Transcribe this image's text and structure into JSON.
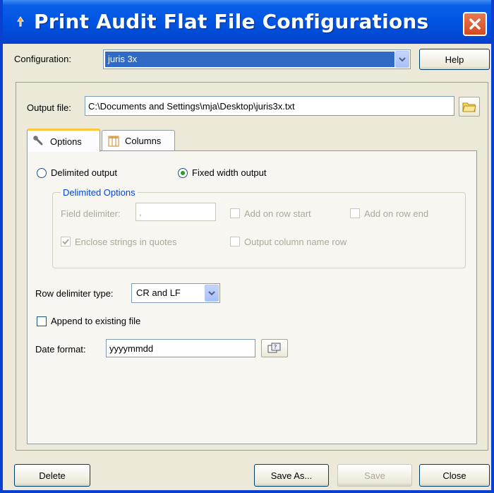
{
  "window": {
    "title": "Print Audit Flat File Configurations"
  },
  "configuration": {
    "label": "Configuration:",
    "selected": "juris 3x",
    "help_label": "Help"
  },
  "output_file": {
    "label": "Output file:",
    "value": "C:\\Documents and Settings\\mja\\Desktop\\juris3x.txt"
  },
  "tabs": [
    {
      "label": "Options",
      "icon": "wrench-icon",
      "active": true
    },
    {
      "label": "Columns",
      "icon": "columns-icon",
      "active": false
    }
  ],
  "options": {
    "delimited_output_label": "Delimited output",
    "fixed_width_output_label": "Fixed width output",
    "output_mode": "fixed",
    "delimited_options": {
      "title": "Delimited Options",
      "field_delimiter_label": "Field delimiter:",
      "field_delimiter_value": ",",
      "add_on_row_start_label": "Add on row start",
      "add_on_row_end_label": "Add on row end",
      "enclose_strings_label": "Enclose strings in quotes",
      "output_column_name_row_label": "Output column name row"
    },
    "row_delimiter_label": "Row delimiter type:",
    "row_delimiter_value": "CR and LF",
    "append_label": "Append to existing file",
    "date_format_label": "Date format:",
    "date_format_value": "yyyymmdd"
  },
  "footer": {
    "delete_label": "Delete",
    "save_as_label": "Save As...",
    "save_label": "Save",
    "close_label": "Close"
  },
  "colors": {
    "titlebar": "#0054e3",
    "selection": "#316ac5",
    "group_title": "#0046d5",
    "radio_dot": "#21a121"
  }
}
